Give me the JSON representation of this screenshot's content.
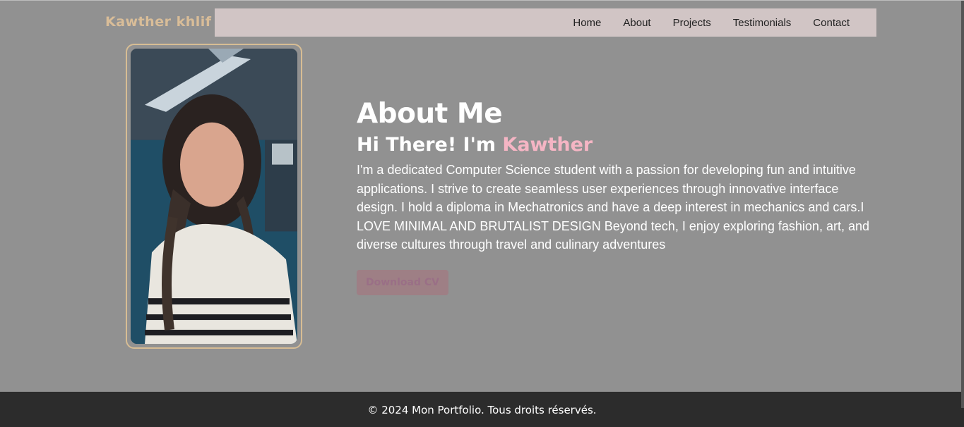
{
  "header": {
    "logo": "Kawther khlif",
    "nav": [
      "Home",
      "About",
      "Projects",
      "Testimonials",
      "Contact"
    ]
  },
  "about": {
    "title": "About Me",
    "greeting_prefix": "Hi There! I'm ",
    "greeting_name": "Kawther",
    "bio": "I'm a dedicated Computer Science student with a passion for developing fun and intuitive applications. I strive to create seamless user experiences through innovative interface design. I hold a diploma in Mechatronics and have a deep interest in mechanics and cars.I LOVE MINIMAL AND BRUTALIST DESIGN Beyond tech, I enjoy exploring fashion, art, and diverse cultures through travel and culinary adventures",
    "cv_button": "Download CV"
  },
  "footer": {
    "text": "© 2024 Mon Portfolio. Tous droits réservés."
  },
  "colors": {
    "accent_pink": "#f5b5c4",
    "logo_tan": "#d9bd98",
    "navbar_bg": "#d1c5c5",
    "page_bg": "#919191",
    "footer_bg": "#2c2c2c"
  }
}
